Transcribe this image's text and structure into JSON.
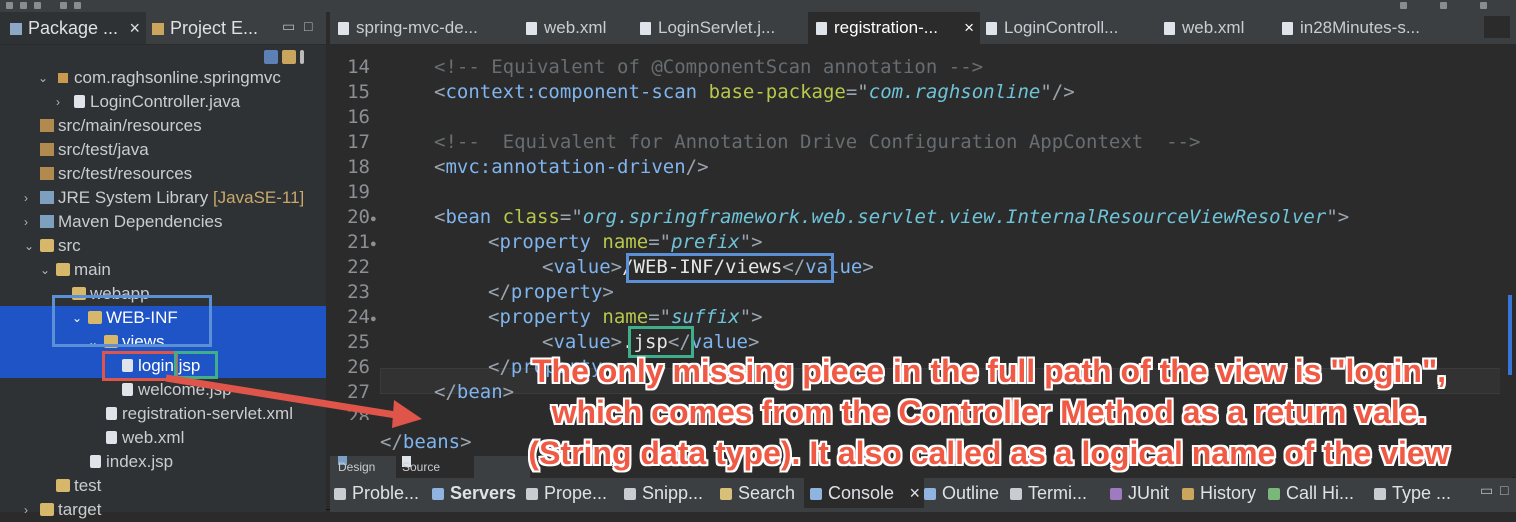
{
  "left_panel": {
    "tabs": [
      {
        "label": "Package ...",
        "close": "×"
      },
      {
        "label": "Project E..."
      }
    ],
    "tree": [
      {
        "label": "com.raghsonline.springmvc"
      },
      {
        "label": "LoginController.java"
      },
      {
        "label": "src/main/resources"
      },
      {
        "label": "src/test/java"
      },
      {
        "label": "src/test/resources"
      },
      {
        "label": "JRE System Library",
        "decoration": "[JavaSE-11]"
      },
      {
        "label": "Maven Dependencies"
      },
      {
        "label": "src"
      },
      {
        "label": "main"
      },
      {
        "label": "webapp"
      },
      {
        "label": "WEB-INF"
      },
      {
        "label": "views"
      },
      {
        "label": "login.jsp"
      },
      {
        "label": "welcome.jsp"
      },
      {
        "label": "registration-servlet.xml"
      },
      {
        "label": "web.xml"
      },
      {
        "label": "index.jsp"
      },
      {
        "label": "test"
      },
      {
        "label": "target"
      }
    ]
  },
  "editor": {
    "tabs": [
      {
        "label": "spring-mvc-de..."
      },
      {
        "label": "web.xml"
      },
      {
        "label": "LoginServlet.j..."
      },
      {
        "label": "registration-...",
        "close": "×"
      },
      {
        "label": "LoginControll..."
      },
      {
        "label": "web.xml"
      },
      {
        "label": "in28Minutes-s..."
      }
    ],
    "line_numbers": [
      "14",
      "15",
      "16",
      "17",
      "18",
      "19",
      "20",
      "21",
      "22",
      "23",
      "24",
      "25",
      "26",
      "27",
      "28"
    ],
    "lines": {
      "l14": "<!-- Equivalent of @ComponentScan annotation -->",
      "l15_open": "<",
      "l15_tag": "context:component-scan",
      "l15_attr": "base-package",
      "l15_eq": "=\"",
      "l15_val": "com.raghsonline",
      "l15_close": "\"/>",
      "l17": "<!--  Equivalent for Annotation Drive Configuration AppContext  -->",
      "l18_open": "<",
      "l18_tag": "mvc:annotation-driven",
      "l18_close": "/>",
      "l20_open": "<",
      "l20_tag": "bean",
      "l20_attr": "class",
      "l20_eq": "=\"",
      "l20_val": "org.springframework.web.servlet.view.InternalResourceViewResolver",
      "l20_close": "\">",
      "l21_open": "<",
      "l21_tag": "property",
      "l21_attr": "name",
      "l21_eq": "=\"",
      "l21_val": "prefix",
      "l21_close": "\">",
      "l22_open": "<",
      "l22_tag": "value",
      "l22_gt": ">",
      "l22_text": "/WEB-INF/views",
      "l22_lt": "</",
      "l22_tag2": "value",
      "l22_close": ">",
      "l23_open": "</",
      "l23_tag": "property",
      "l23_close": ">",
      "l24_open": "<",
      "l24_tag": "property",
      "l24_attr": "name",
      "l24_eq": "=\"",
      "l24_val": "suffix",
      "l24_close": "\">",
      "l25_open": "<",
      "l25_tag": "value",
      "l25_gt": ">",
      "l25_text": ".jsp",
      "l25_lt": "</",
      "l25_tag2": "value",
      "l25_close": ">",
      "l26_open": "</",
      "l26_tag": "property",
      "l26_close": ">",
      "l27_open": "</",
      "l27_tag": "bean",
      "l27_close": ">",
      "l29_open": "</",
      "l29_tag": "beans",
      "l29_close": ">"
    },
    "view_tabs": {
      "design": "Design",
      "source": "Source"
    }
  },
  "bottom_bar": {
    "tabs": [
      {
        "label": "Proble..."
      },
      {
        "label": "Servers"
      },
      {
        "label": "Prope..."
      },
      {
        "label": "Snipp..."
      },
      {
        "label": "Search"
      },
      {
        "label": "Console",
        "close": "×"
      },
      {
        "label": "Outline"
      },
      {
        "label": "Termi..."
      },
      {
        "label": "JUnit"
      },
      {
        "label": "History"
      },
      {
        "label": "Call Hi..."
      },
      {
        "label": "Type ..."
      }
    ]
  },
  "annotation": {
    "line1": "The only missing piece in the full path of the view is \"login\",",
    "line2": "which comes from the Controller Method as a return vale.",
    "line3": "(String data type). It also called as a logical name of the view"
  },
  "colors": {
    "selection": "#1f54c7",
    "highlight_blue": "#5b8fd6",
    "highlight_green": "#3fae8a",
    "highlight_red": "#e0554a",
    "annotation_red": "#f05a44"
  }
}
